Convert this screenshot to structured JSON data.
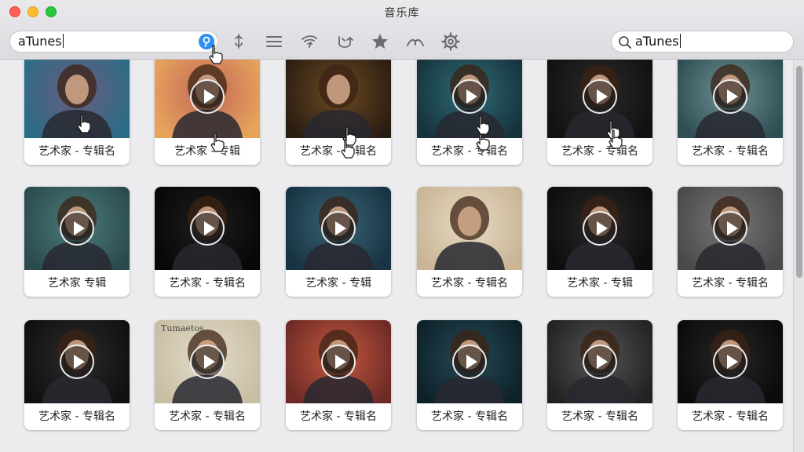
{
  "window": {
    "title": "音乐库"
  },
  "toolbar": {
    "search_left_value": "aTunes",
    "search_right_value": "aTunes",
    "clear_glyph": "⚲",
    "tools": [
      {
        "name": "genre-icon"
      },
      {
        "name": "list-icon"
      },
      {
        "name": "signal-icon"
      },
      {
        "name": "refresh-icon"
      },
      {
        "name": "star-icon"
      },
      {
        "name": "wing-icon"
      },
      {
        "name": "gear-icon"
      }
    ]
  },
  "grid": {
    "rows": [
      [
        {
          "label": "艺术家 - 专辑名",
          "play": false,
          "bg": "#6c5a7e",
          "bg2": "#2b6d87"
        },
        {
          "label": "艺术家 - 专辑",
          "play": true,
          "bg": "#c0685a",
          "bg2": "#e8a35b"
        },
        {
          "label": "艺术家 - 专辑名",
          "play": false,
          "bg": "#6d4a22",
          "bg2": "#2a1d12"
        },
        {
          "label": "艺术家 - 专辑名",
          "play": true,
          "bg": "#2f6b76",
          "bg2": "#16333c"
        },
        {
          "label": "艺术家 - 专辑名",
          "play": true,
          "bg": "#2a2a2a",
          "bg2": "#111111"
        },
        {
          "label": "艺术家 - 专辑名",
          "play": true,
          "bg": "#6f9294",
          "bg2": "#2d4e53"
        }
      ],
      [
        {
          "label": "艺术家 专辑",
          "play": true,
          "bg": "#4d7c7a",
          "bg2": "#2b4a4f"
        },
        {
          "label": "艺术家 - 专辑名",
          "play": true,
          "bg": "#1e1e1e",
          "bg2": "#070707"
        },
        {
          "label": "艺术家 - 专辑",
          "play": true,
          "bg": "#3a6474",
          "bg2": "#183343"
        },
        {
          "label": "艺术家 - 专辑名",
          "play": false,
          "bg": "#e6dac3",
          "bg2": "#c9b596"
        },
        {
          "label": "艺术家 - 专辑",
          "play": true,
          "bg": "#2a2828",
          "bg2": "#0d0d0d"
        },
        {
          "label": "艺术家 - 专辑名",
          "play": true,
          "bg": "#777777",
          "bg2": "#4a4a4a"
        }
      ],
      [
        {
          "label": "艺术家 - 专辑名",
          "play": true,
          "bg": "#2b2b2b",
          "bg2": "#101010"
        },
        {
          "label": "艺术家 - 专辑名",
          "play": true,
          "bg": "#e2dccb",
          "bg2": "#c8bea3",
          "caption": "Tumaetos"
        },
        {
          "label": "艺术家 - 专辑名",
          "play": true,
          "bg": "#c45a3f",
          "bg2": "#6e2a26"
        },
        {
          "label": "艺术家 - 专辑名",
          "play": true,
          "bg": "#264b57",
          "bg2": "#0e2128"
        },
        {
          "label": "艺术家 - 专辑名",
          "play": true,
          "bg": "#555555",
          "bg2": "#222222"
        },
        {
          "label": "艺术家 - 专辑名",
          "play": true,
          "bg": "#262626",
          "bg2": "#0b0b0b"
        }
      ]
    ]
  }
}
